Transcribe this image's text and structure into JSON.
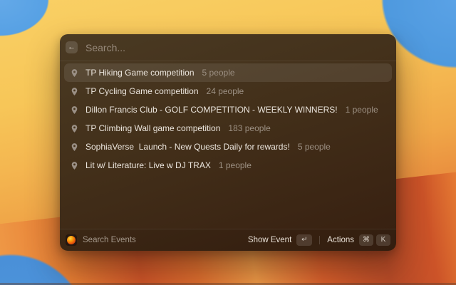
{
  "search": {
    "placeholder": "Search...",
    "back_icon": "←"
  },
  "results": [
    {
      "title": "TP Hiking Game competition",
      "people": "5 people",
      "selected": true
    },
    {
      "title": "TP Cycling Game competition",
      "people": "24 people",
      "selected": false
    },
    {
      "title": "Dillon Francis Club - GOLF COMPETITION - WEEKLY WINNERS!",
      "people": "1 people",
      "selected": false
    },
    {
      "title": "TP Climbing Wall game competition",
      "people": "183 people",
      "selected": false
    },
    {
      "title": "SophiaVerse  Launch - New Quests Daily for rewards!",
      "people": "5 people",
      "selected": false
    },
    {
      "title": "Lit w/ Literature: Live w DJ TRAX",
      "people": "1 people",
      "selected": false
    }
  ],
  "footer": {
    "source_label": "Search Events",
    "primary_action": {
      "label": "Show Event",
      "key": "↵"
    },
    "secondary_action": {
      "label": "Actions",
      "keys": [
        "⌘",
        "K"
      ]
    }
  },
  "colors": {
    "panel_top": "#4a3a23",
    "panel_bottom": "#371f10",
    "selection_overlay": "rgba(255,255,255,0.09)",
    "title_text": "#ebe5dd",
    "muted_text": "#9c9083",
    "placeholder_text": "#97897b"
  }
}
